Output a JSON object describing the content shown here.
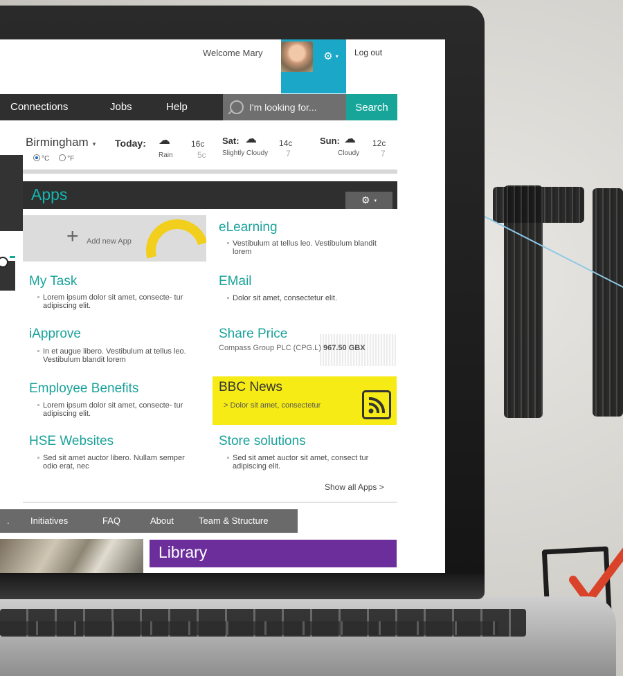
{
  "header": {
    "welcome": "Welcome Mary",
    "logout": "Log out",
    "gear_glyph": "⚙",
    "dropdown_glyph": "▾"
  },
  "nav": {
    "items": [
      "Connections",
      "Jobs",
      "Help"
    ],
    "search_placeholder": "I'm looking for...",
    "search_button": "Search"
  },
  "weather": {
    "city": "Birmingham",
    "city_caret": "▾",
    "today_label": "Today:",
    "today_desc": "Rain",
    "today_high": "16c",
    "today_low": "5c",
    "unit_c": "°C",
    "unit_f": "°F",
    "sat_label": "Sat:",
    "sat_high": "14c",
    "sat_low": "7",
    "sat_desc": "Slightly Cloudy",
    "sun_label": "Sun:",
    "sun_high": "12c",
    "sun_low": "7",
    "sun_desc": "Cloudy"
  },
  "apps": {
    "title": "Apps",
    "add_new": "Add new App",
    "add_plus": "+",
    "tiles": [
      {
        "title": "eLearning",
        "text": "Vestibulum at tellus leo. Vestibulum blandit lorem"
      },
      {
        "title": "My Task",
        "text": "Lorem ipsum dolor sit amet, consecte- tur adipiscing elit."
      },
      {
        "title": "EMail",
        "text": "Dolor sit amet, consectetur elit."
      },
      {
        "title": "iApprove",
        "text": "In et augue libero. Vestibulum at tellus leo. Vestibulum blandit lorem"
      },
      {
        "title": "Share Price",
        "text": "Compass Group PLC (CPG.L)",
        "value": "967.50 GBX"
      },
      {
        "title": "Employee Benefits",
        "text": "Lorem ipsum dolor sit amet, consecte- tur adipiscing elit."
      },
      {
        "title": "BBC News",
        "text": "> Dolor sit amet, consectetur"
      },
      {
        "title": "HSE Websites",
        "text": "Sed sit amet auctor libero. Nullam semper odio erat, nec"
      },
      {
        "title": "Store solutions",
        "text": "Sed sit amet auctor  sit amet, consect tur adipiscing elit."
      }
    ],
    "show_all": "Show all Apps >"
  },
  "bottom_nav": [
    ".",
    "Initiatives",
    "FAQ",
    "About",
    "Team & Structure"
  ],
  "library": {
    "title": "Library"
  },
  "colors": {
    "teal": "#17a59a",
    "cyan": "#1ba7c8",
    "purple": "#6b2e9b",
    "yellow": "#f6eb14",
    "dark": "#2f2f2f"
  }
}
